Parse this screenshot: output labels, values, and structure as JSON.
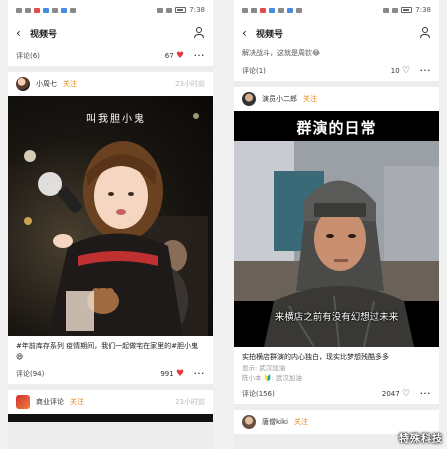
{
  "status": {
    "time": "7:38"
  },
  "nav": {
    "title": "视频号"
  },
  "left": {
    "top_bar": {
      "comments": "评论(6)",
      "likes": "67"
    },
    "post": {
      "author": "小周七",
      "follow": "关注",
      "time": "23小时前",
      "video_text": "叫我胆小鬼",
      "caption": "#年前库存系列 疫情期间，我们一起做宅在家里的#胆小鬼😄",
      "comments": "评论(94)",
      "likes": "991"
    },
    "next_post": {
      "author": "商业评论",
      "follow": "关注",
      "time": "23小时前"
    }
  },
  "right": {
    "top_caption": "解决战斗，这就是周钦😂",
    "top_bar": {
      "comments": "评论(1)",
      "likes": "10"
    },
    "post": {
      "author": "演员小二郎",
      "follow": "关注",
      "video_title": "群演的日常",
      "video_subtitle": "来横店之前有没有幻想过未来",
      "caption": "实拍横店群演的内心独白，现实比梦想残酷多多",
      "location": "显示: 武汉加油",
      "mention": "陈小本 🔰: 武汉加油",
      "comments": "评论(156)",
      "likes": "2047"
    },
    "next_post": {
      "author": "唐僧kiki",
      "follow": "关注"
    }
  },
  "watermark": "特殊科技"
}
